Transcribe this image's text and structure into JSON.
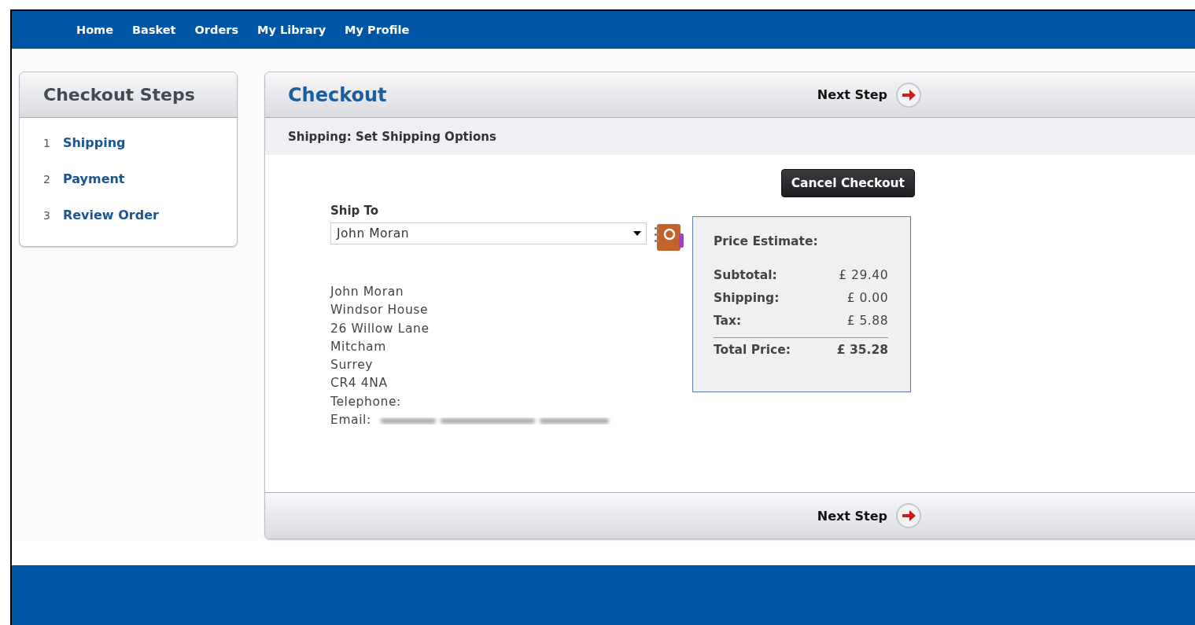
{
  "nav": [
    {
      "label": "Home"
    },
    {
      "label": "Basket"
    },
    {
      "label": "Orders"
    },
    {
      "label": "My Library"
    },
    {
      "label": "My Profile"
    }
  ],
  "steps_panel": {
    "title": "Checkout Steps",
    "steps": [
      {
        "number": "1",
        "label": "Shipping"
      },
      {
        "number": "2",
        "label": "Payment"
      },
      {
        "number": "3",
        "label": "Review Order"
      }
    ]
  },
  "checkout": {
    "title": "Checkout",
    "next_step_top": "Next Step",
    "subtitle": "Shipping: Set Shipping Options",
    "cancel_button": "Cancel Checkout",
    "ship_to": {
      "label": "Ship To",
      "value": "John Moran"
    },
    "address_lines": [
      "John Moran",
      "Windsor House",
      "26 Willow Lane",
      "Mitcham",
      "Surrey",
      "CR4 4NA",
      "Telephone:"
    ],
    "email_label": "Email:",
    "price_estimate": {
      "title": "Price Estimate:",
      "rows": [
        {
          "label": "Subtotal:",
          "value": "£ 29.40"
        },
        {
          "label": "Shipping:",
          "value": "£ 0.00"
        },
        {
          "label": "Tax:",
          "value": "£ 5.88"
        }
      ],
      "total": {
        "label": "Total Price:",
        "value": "£ 35.28"
      }
    },
    "next_step_bottom": "Next Step"
  }
}
